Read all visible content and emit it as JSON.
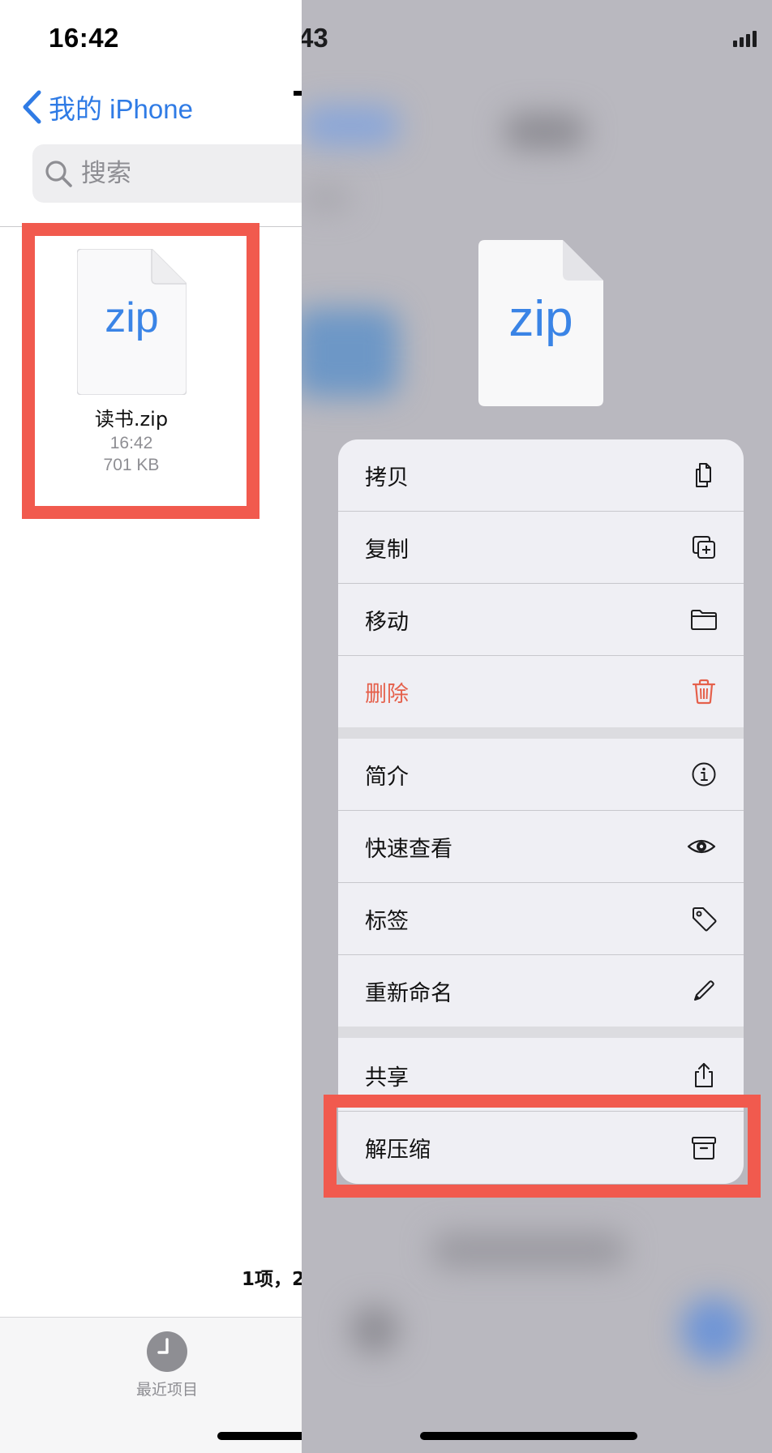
{
  "left": {
    "status_time": "16:42",
    "back_label": "我的 iPhone",
    "search_placeholder": "搜索",
    "file": {
      "ext": "zip",
      "name": "读书.zip",
      "time": "16:42",
      "size": "701 KB"
    },
    "item_count": "1项，2",
    "tab_recent_label": "最近项目"
  },
  "right": {
    "status_time_fragment": "43",
    "preview_ext": "zip",
    "menu": {
      "copy": "拷贝",
      "duplicate": "复制",
      "move": "移动",
      "delete": "删除",
      "info": "简介",
      "quick_look": "快速查看",
      "tags": "标签",
      "rename": "重新命名",
      "share": "共享",
      "uncompress": "解压缩"
    }
  },
  "colors": {
    "accent": "#2f7be5",
    "destructive": "#e5604b",
    "highlight": "#f15a4e"
  }
}
